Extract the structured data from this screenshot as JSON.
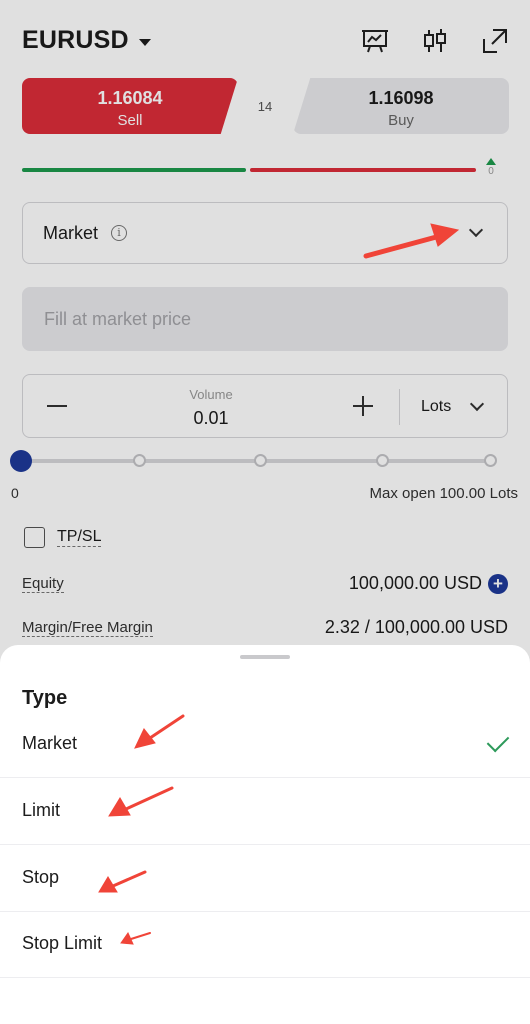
{
  "header": {
    "symbol": "EURUSD",
    "icons": [
      "presentation-chart-icon",
      "candlestick-icon",
      "expand-icon"
    ]
  },
  "quote": {
    "sell_price": "1.16084",
    "sell_label": "Sell",
    "buy_price": "1.16098",
    "buy_label": "Buy",
    "spread": "14",
    "indicator_value": "0"
  },
  "order_type": {
    "label": "Market"
  },
  "price_field": {
    "placeholder": "Fill at market price"
  },
  "volume": {
    "label": "Volume",
    "value": "0.01",
    "unit": "Lots"
  },
  "slider": {
    "min_label": "0",
    "max_label": "Max open 100.00 Lots",
    "level": 0
  },
  "tpsl": {
    "label": "TP/SL",
    "checked": false
  },
  "account": {
    "equity_label": "Equity",
    "equity_value": "100,000.00 USD",
    "margin_label": "Margin/Free Margin",
    "margin_value": "2.32 / 100,000.00 USD"
  },
  "sheet": {
    "title": "Type",
    "options": [
      {
        "label": "Market",
        "selected": true
      },
      {
        "label": "Limit",
        "selected": false
      },
      {
        "label": "Stop",
        "selected": false
      },
      {
        "label": "Stop Limit",
        "selected": false
      }
    ]
  },
  "colors": {
    "sell": "#dc2d39",
    "buy_bg": "#e9e9ec",
    "accent_blue": "#1e3a9a",
    "green": "#1d9a4d",
    "annotation_arrow": "#f04438"
  }
}
